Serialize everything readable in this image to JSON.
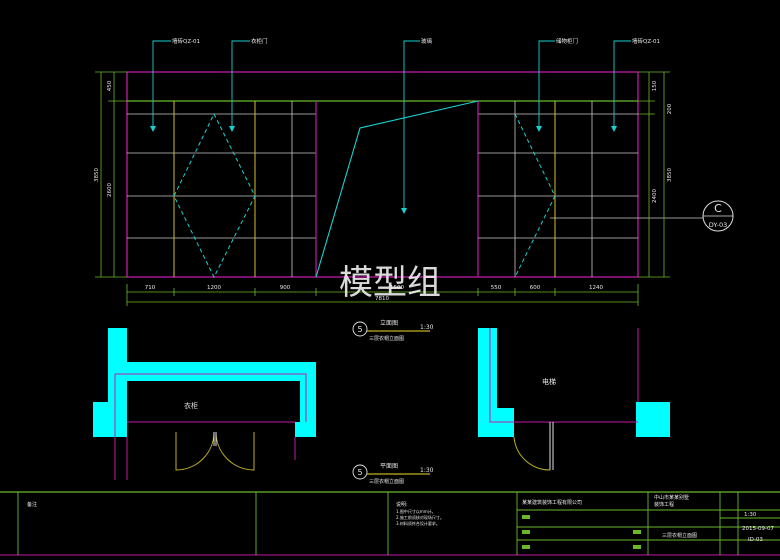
{
  "elevation": {
    "callouts": [
      "墙砖QZ-01",
      "衣柜门",
      "玻璃",
      "储物柜门",
      "墙砖QZ-01"
    ],
    "left_dims": [
      "3850",
      "2600",
      "450"
    ],
    "right_dims": [
      "200",
      "150",
      "2400",
      "3850"
    ],
    "bottom_dims": [
      "710",
      "1200",
      "900",
      "1500",
      "550",
      "600",
      "1240"
    ],
    "total_dim": "7810",
    "section_mark": {
      "letter": "C",
      "code": "DY-03"
    },
    "title": {
      "number": "5",
      "name": "立面图",
      "scale": "1:30",
      "sub": "三层衣帽立面图"
    }
  },
  "plan": {
    "room_left": "衣柜",
    "room_right": "电梯",
    "title": {
      "number": "5",
      "name": "平面图",
      "scale": "1:30",
      "sub": "三层衣帽立面图"
    }
  },
  "watermark": "模型组",
  "title_block": {
    "remark_label": "备注",
    "notes_label": "说明:",
    "notes": [
      "1.图中尺寸以mm计。",
      "2.施工前须核对现场尺寸。",
      "3.材料须符合设计要求。"
    ],
    "company": "某某建筑装饰工程有限公司",
    "project_line1": "中山市某某别墅",
    "project_line2": "装饰工程",
    "drawing_title": "三层衣帽立面图",
    "scale": "1:30",
    "date": "2015-09-07",
    "sheet": "ID-03"
  }
}
